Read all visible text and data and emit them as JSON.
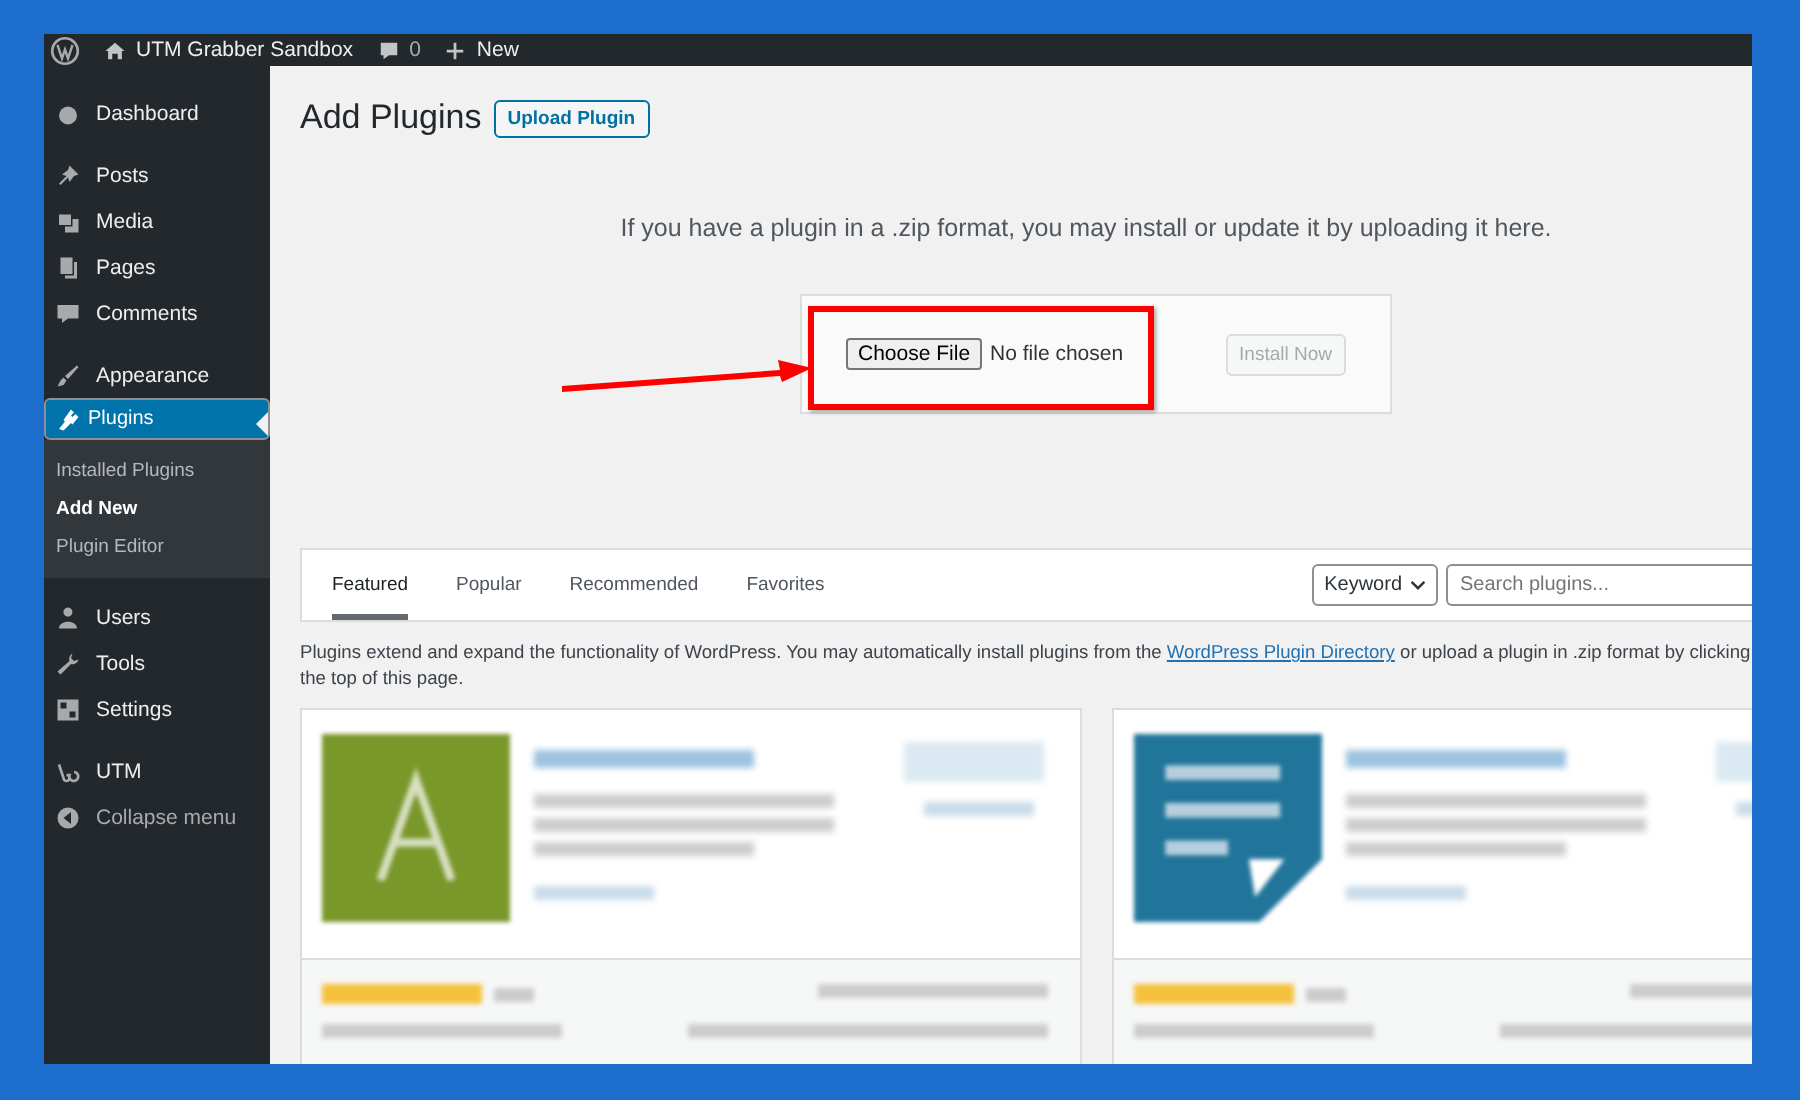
{
  "admin_bar": {
    "site_name": "UTM Grabber Sandbox",
    "comments_count": "0",
    "new_label": "New"
  },
  "sidebar": {
    "items": [
      {
        "label": "Dashboard",
        "selected": false
      },
      {
        "label": "Posts",
        "selected": false
      },
      {
        "label": "Media",
        "selected": false
      },
      {
        "label": "Pages",
        "selected": false
      },
      {
        "label": "Comments",
        "selected": false
      },
      {
        "label": "Appearance",
        "selected": false
      },
      {
        "label": "Plugins",
        "selected": true,
        "children": [
          {
            "label": "Installed Plugins",
            "selected": false
          },
          {
            "label": "Add New",
            "selected": true
          },
          {
            "label": "Plugin Editor",
            "selected": false
          }
        ]
      },
      {
        "label": "Users",
        "selected": false
      },
      {
        "label": "Tools",
        "selected": false
      },
      {
        "label": "Settings",
        "selected": false
      },
      {
        "label": "UTM",
        "selected": false
      },
      {
        "label": "Collapse menu",
        "selected": false
      }
    ]
  },
  "page": {
    "title": "Add Plugins",
    "title_button": "Upload Plugin",
    "upload_help": "If you have a plugin in a .zip format, you may install or update it by uploading it here.",
    "choose_file": "Choose File",
    "file_status": "No file chosen",
    "install_button": "Install Now"
  },
  "filter_bar": {
    "tabs": [
      {
        "label": "Featured",
        "selected": true
      },
      {
        "label": "Popular",
        "selected": false
      },
      {
        "label": "Recommended",
        "selected": false
      },
      {
        "label": "Favorites",
        "selected": false
      }
    ],
    "search_type": "Keyword",
    "search_placeholder": "Search plugins..."
  },
  "description": {
    "before": "Plugins extend and expand the functionality of WordPress. You may automatically install plugins from the ",
    "link": "WordPress Plugin Directory",
    "after": " or upload a plugin in .zip format by clicking",
    "line2": "the top of this page."
  },
  "plugin_cards": [
    {
      "kind": "letter-logo"
    },
    {
      "kind": "document-logo"
    }
  ]
}
